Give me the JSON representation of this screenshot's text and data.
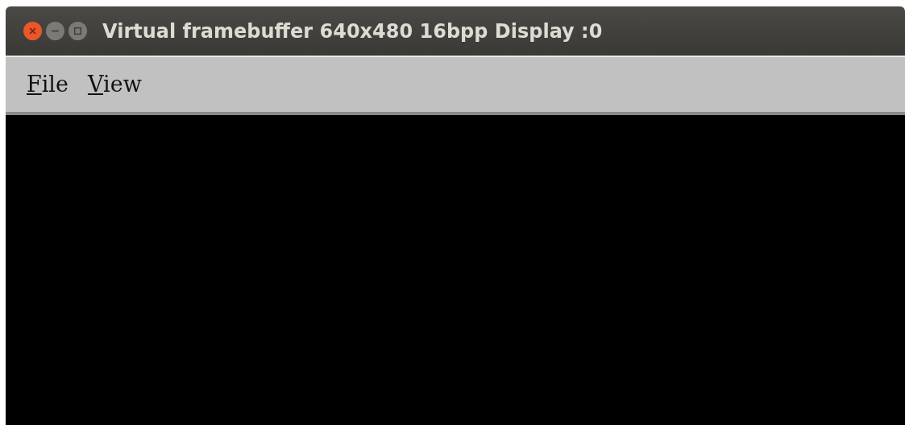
{
  "window": {
    "title": "Virtual framebuffer 640x480 16bpp Display :0"
  },
  "menu": [
    {
      "underlined": "F",
      "rest": "ile"
    },
    {
      "underlined": "V",
      "rest": "iew"
    }
  ]
}
